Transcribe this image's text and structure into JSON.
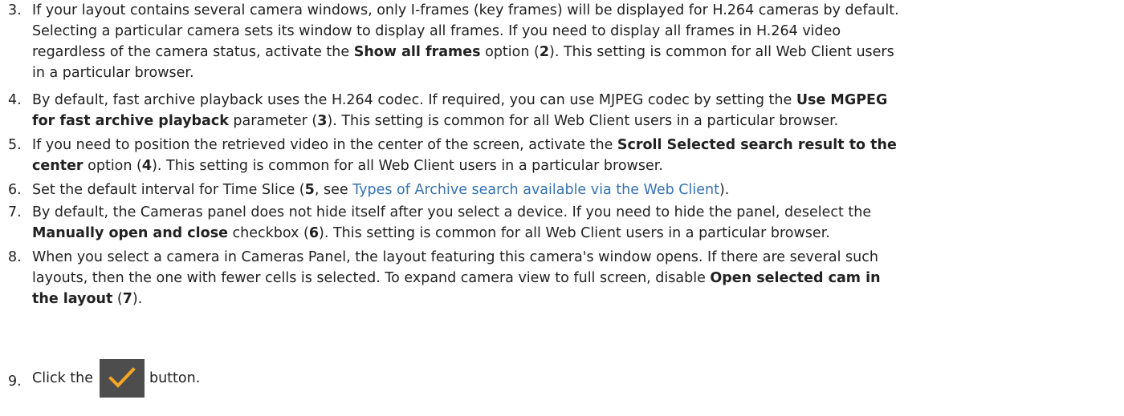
{
  "steps": [
    {
      "number": "3.",
      "lines": [
        [
          {
            "t": "If your layout contains several camera windows, only I-frames (key frames) will be displayed for H.264 cameras by default."
          }
        ],
        [
          {
            "t": "Selecting a particular camera sets its window to display all frames. If you need to display all frames in H.264 video"
          }
        ],
        [
          {
            "t": "regardless of the camera status, activate the "
          },
          {
            "b": "Show all frames"
          },
          {
            "t": " option ("
          },
          {
            "b": "2"
          },
          {
            "t": ").  This setting is common for all Web Client users"
          }
        ],
        [
          {
            "t": "in a particular browser."
          }
        ]
      ]
    },
    {
      "number": "4.",
      "lines": [
        [
          {
            "t": "By default, fast archive playback uses the H.264 codec. If required, you can use MJPEG codec by setting the "
          },
          {
            "b": "Use MGPEG"
          }
        ],
        [
          {
            "b": "for fast archive playback"
          },
          {
            "t": " parameter ("
          },
          {
            "b": "3"
          },
          {
            "t": ").  This setting is common for all Web Client users in a particular browser."
          }
        ]
      ]
    },
    {
      "number": "5.",
      "lines": [
        [
          {
            "t": "If you need to position the retrieved video in the center of the screen, activate the "
          },
          {
            "b": "Scroll Selected search result to the"
          }
        ],
        [
          {
            "b": "center"
          },
          {
            "t": " option ("
          },
          {
            "b": "4"
          },
          {
            "t": ").  This setting is common for all Web Client users in a particular browser."
          }
        ]
      ]
    },
    {
      "number": "6.",
      "lines": [
        [
          {
            "t": "Set the default interval for Time Slice ("
          },
          {
            "b": "5"
          },
          {
            "t": ", see "
          },
          {
            "a": "Types of Archive search available via the Web Client"
          },
          {
            "t": ")."
          }
        ]
      ]
    },
    {
      "number": "7.",
      "lines": [
        [
          {
            "t": "By default, the Cameras panel does not hide itself after you select a device. If you need to hide the panel, deselect the"
          }
        ],
        [
          {
            "b": "Manually open and close"
          },
          {
            "t": " checkbox ("
          },
          {
            "b": "6"
          },
          {
            "t": ").  This setting is common for all Web Client users in a particular browser."
          }
        ]
      ]
    },
    {
      "number": "8.",
      "lines": [
        [
          {
            "t": "When you select a camera in  Cameras Panel, the layout featuring this camera's window opens. If there are several such"
          }
        ],
        [
          {
            "t": "layouts, then the one with fewer cells is selected. To expand camera view to full screen, disable  "
          },
          {
            "b": "Open selected cam in"
          }
        ],
        [
          {
            "b": "the layout"
          },
          {
            "t": " ("
          },
          {
            "b": "7"
          },
          {
            "t": ")."
          }
        ]
      ]
    }
  ],
  "step9": {
    "number": "9.",
    "before": "Click the",
    "after": "button.",
    "button_icon": "checkmark-icon",
    "button_bg": "#4d4d4d",
    "check_color": "#f5a623"
  },
  "colors": {
    "text": "#222222",
    "link": "#3572b0"
  }
}
